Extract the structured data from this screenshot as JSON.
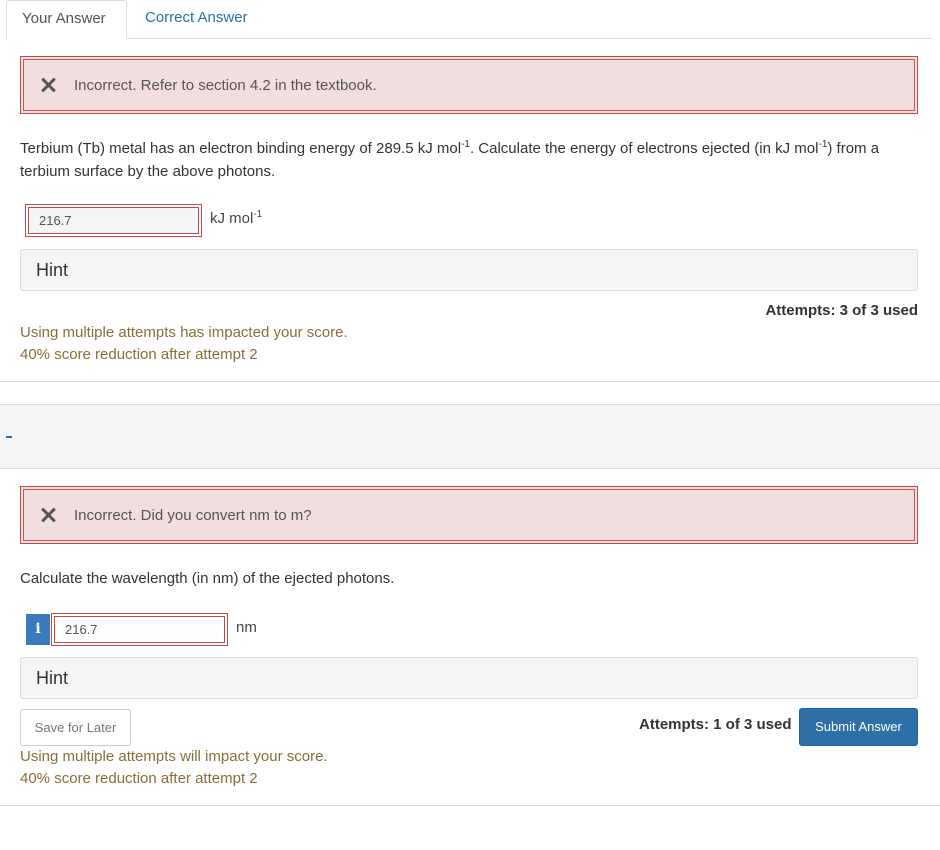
{
  "tabs": {
    "your_answer": "Your Answer",
    "correct_answer": "Correct Answer"
  },
  "part1": {
    "feedback": "Incorrect. Refer to section 4.2 in the textbook.",
    "question_a": "Terbium (Tb) metal has an electron binding energy of 289.5 kJ mol",
    "question_b": "-1",
    "question_c": ". Calculate the energy of electrons ejected (in kJ mol",
    "question_d": "-1",
    "question_e": ") from a terbium surface by the above photons.",
    "answer_value": "216.7",
    "unit_base": "kJ mol",
    "unit_exp": "-1",
    "hint_label": "Hint",
    "attempts": "Attempts: 3 of 3 used",
    "score_line1": "Using multiple attempts has impacted your score.",
    "score_line2": "40% score reduction after attempt 2"
  },
  "part2": {
    "feedback": "Incorrect. Did you convert nm to m?",
    "question": "Calculate the wavelength (in nm) of the ejected photons.",
    "info_icon_glyph": "i",
    "answer_value": "216.7",
    "unit": "nm",
    "hint_label": "Hint",
    "save_label": "Save for Later",
    "attempts": "Attempts: 1 of 3 used",
    "submit_label": "Submit Answer",
    "score_line1": "Using multiple attempts will impact your score.",
    "score_line2": "40% score reduction after attempt 2"
  },
  "colors": {
    "error_border": "#b94a4a",
    "error_bg": "#f2dede",
    "link": "#2a6fa8",
    "warning_text": "#8a6d3b",
    "primary_button": "#2e6fa8"
  },
  "icons": {
    "feedback": "close-x-icon",
    "info": "info-icon"
  }
}
